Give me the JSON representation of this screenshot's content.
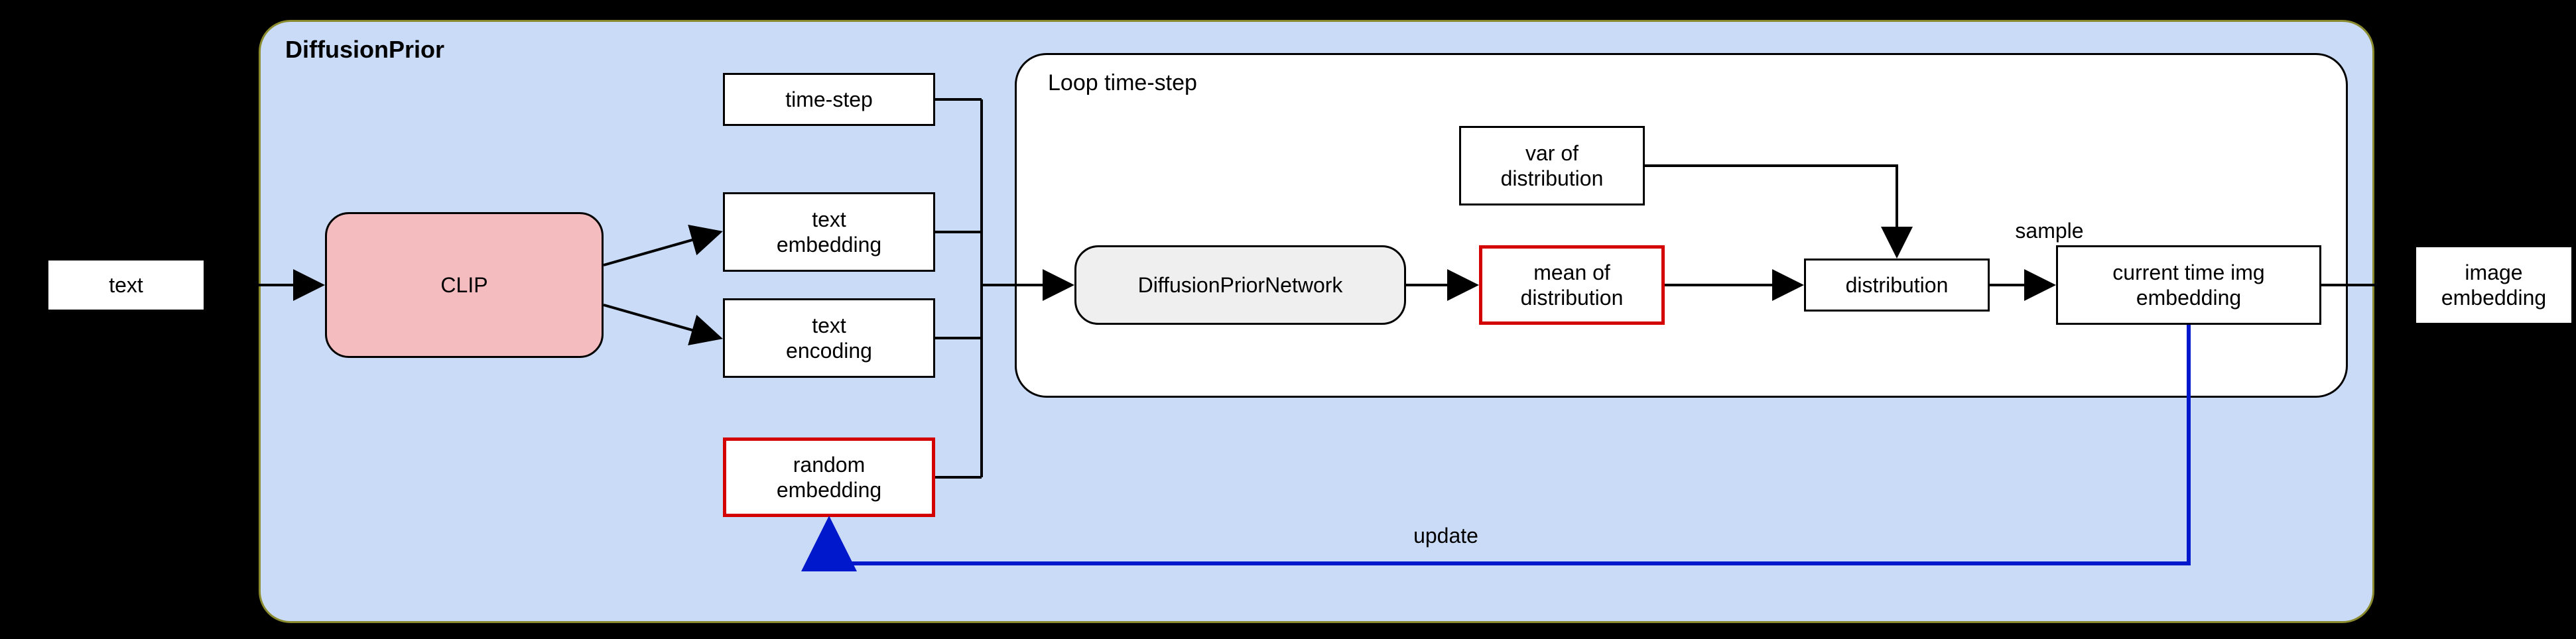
{
  "input": {
    "label": "text"
  },
  "output": {
    "label": "image\nembedding"
  },
  "outer_panel": {
    "title": "DiffusionPrior"
  },
  "clip": {
    "label": "CLIP"
  },
  "mid": {
    "timestep": "time-step",
    "text_embedding": "text\nembedding",
    "text_encoding": "text\nencoding",
    "random_embedding": "random\nembedding"
  },
  "loop_panel": {
    "title": "Loop time-step"
  },
  "network": {
    "label": "DiffusionPriorNetwork"
  },
  "mean": {
    "label": "mean of\ndistribution"
  },
  "var": {
    "label": "var of\ndistribution"
  },
  "dist": {
    "label": "distribution"
  },
  "sample_label": "sample",
  "current": {
    "label": "current time img\nembedding"
  },
  "update_label": "update"
}
